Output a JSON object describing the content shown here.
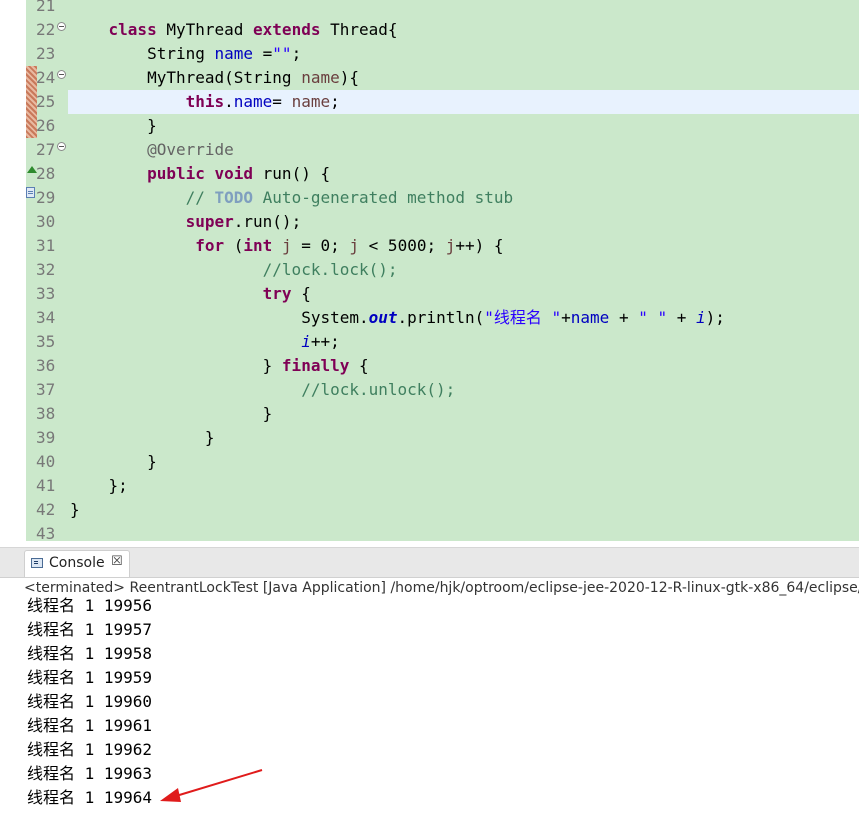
{
  "editor": {
    "lines": [
      {
        "n": "21",
        "tokens": []
      },
      {
        "n": "22",
        "tokens": [
          {
            "t": "    "
          },
          {
            "t": "class",
            "c": "kw"
          },
          {
            "t": " MyThread "
          },
          {
            "t": "extends",
            "c": "kw"
          },
          {
            "t": " Thread{"
          }
        ]
      },
      {
        "n": "23",
        "tokens": [
          {
            "t": "        String "
          },
          {
            "t": "name",
            "c": "fld"
          },
          {
            "t": " ="
          },
          {
            "t": "\"\"",
            "c": "str"
          },
          {
            "t": ";"
          }
        ]
      },
      {
        "n": "24",
        "tokens": [
          {
            "t": "        MyThread(String "
          },
          {
            "t": "name",
            "c": "par"
          },
          {
            "t": "){"
          }
        ]
      },
      {
        "n": "25",
        "tokens": [
          {
            "t": "            "
          },
          {
            "t": "this",
            "c": "kw"
          },
          {
            "t": "."
          },
          {
            "t": "name",
            "c": "fld"
          },
          {
            "t": "= "
          },
          {
            "t": "name",
            "c": "par"
          },
          {
            "t": ";"
          }
        ]
      },
      {
        "n": "26",
        "tokens": [
          {
            "t": "        }"
          }
        ]
      },
      {
        "n": "27",
        "tokens": [
          {
            "t": "        "
          },
          {
            "t": "@Override",
            "c": "ann"
          }
        ]
      },
      {
        "n": "28",
        "tokens": [
          {
            "t": "        "
          },
          {
            "t": "public",
            "c": "kw"
          },
          {
            "t": " "
          },
          {
            "t": "void",
            "c": "kw"
          },
          {
            "t": " run() {"
          }
        ]
      },
      {
        "n": "29",
        "tokens": [
          {
            "t": "            "
          },
          {
            "t": "// ",
            "c": "cm"
          },
          {
            "t": "TODO",
            "c": "todo"
          },
          {
            "t": " Auto-generated method stub",
            "c": "cm"
          }
        ]
      },
      {
        "n": "30",
        "tokens": [
          {
            "t": "            "
          },
          {
            "t": "super",
            "c": "kw"
          },
          {
            "t": ".run();"
          }
        ]
      },
      {
        "n": "31",
        "tokens": [
          {
            "t": "             "
          },
          {
            "t": "for",
            "c": "kw"
          },
          {
            "t": " ("
          },
          {
            "t": "int",
            "c": "kw"
          },
          {
            "t": " "
          },
          {
            "t": "j",
            "c": "par"
          },
          {
            "t": " = 0; "
          },
          {
            "t": "j",
            "c": "par"
          },
          {
            "t": " < 5000; "
          },
          {
            "t": "j",
            "c": "par"
          },
          {
            "t": "++) {"
          }
        ]
      },
      {
        "n": "32",
        "tokens": [
          {
            "t": "                    "
          },
          {
            "t": "//lock.lock();",
            "c": "cm"
          }
        ]
      },
      {
        "n": "33",
        "tokens": [
          {
            "t": "                    "
          },
          {
            "t": "try",
            "c": "kw"
          },
          {
            "t": " {"
          }
        ]
      },
      {
        "n": "34",
        "tokens": [
          {
            "t": "                        System."
          },
          {
            "t": "out",
            "c": "fld-bi"
          },
          {
            "t": ".println("
          },
          {
            "t": "\"线程名 \"",
            "c": "str"
          },
          {
            "t": "+"
          },
          {
            "t": "name",
            "c": "fld"
          },
          {
            "t": " + "
          },
          {
            "t": "\" \"",
            "c": "str"
          },
          {
            "t": " + "
          },
          {
            "t": "i",
            "c": "fld-i"
          },
          {
            "t": ");"
          }
        ]
      },
      {
        "n": "35",
        "tokens": [
          {
            "t": "                        "
          },
          {
            "t": "i",
            "c": "fld-i"
          },
          {
            "t": "++;"
          }
        ]
      },
      {
        "n": "36",
        "tokens": [
          {
            "t": "                    } "
          },
          {
            "t": "finally",
            "c": "kw"
          },
          {
            "t": " {"
          }
        ]
      },
      {
        "n": "37",
        "tokens": [
          {
            "t": "                        "
          },
          {
            "t": "//lock.unlock();",
            "c": "cm"
          }
        ]
      },
      {
        "n": "38",
        "tokens": [
          {
            "t": "                    }"
          }
        ]
      },
      {
        "n": "39",
        "tokens": [
          {
            "t": "              }"
          }
        ]
      },
      {
        "n": "40",
        "tokens": [
          {
            "t": "        }"
          }
        ]
      },
      {
        "n": "41",
        "tokens": [
          {
            "t": "    };"
          }
        ]
      },
      {
        "n": "42",
        "tokens": [
          {
            "t": "}"
          }
        ]
      },
      {
        "n": "43",
        "tokens": []
      }
    ]
  },
  "console": {
    "tab_label": "Console",
    "close_glyph": "☒",
    "status": "<terminated> ReentrantLockTest [Java Application] /home/hjk/optroom/eclipse-jee-2020-12-R-linux-gtk-x86_64/eclipse/plugins",
    "output": [
      "线程名 1 19956",
      "线程名 1 19957",
      "线程名 1 19958",
      "线程名 1 19959",
      "线程名 1 19960",
      "线程名 1 19961",
      "线程名 1 19962",
      "线程名 1 19963",
      "线程名 1 19964"
    ]
  },
  "colors": {
    "code_bg": "#cbe8cb",
    "current_line": "#e8f2fe",
    "keyword": "#7f0055",
    "string": "#2a00ff",
    "comment": "#3f7f5f",
    "field": "#0000c0",
    "arrow": "#e01b1b"
  }
}
